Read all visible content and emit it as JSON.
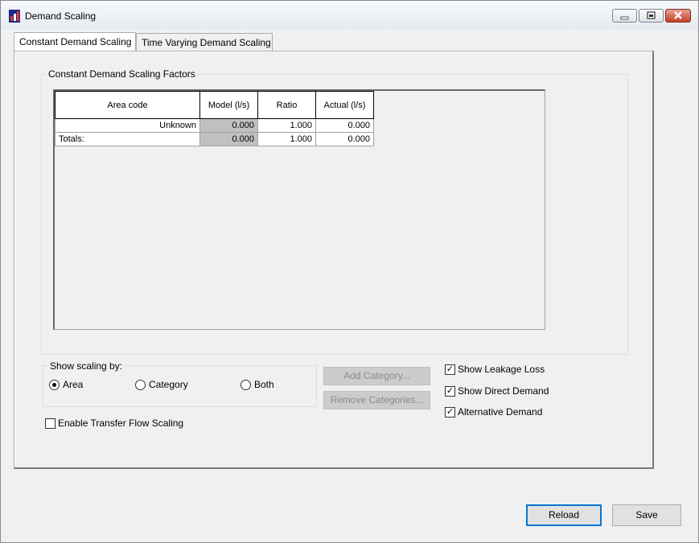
{
  "window": {
    "title": "Demand Scaling"
  },
  "tabs": [
    {
      "label": "Constant Demand Scaling",
      "active": true
    },
    {
      "label": "Time Varying Demand Scaling",
      "active": false
    }
  ],
  "factors_group": {
    "label": "Constant Demand Scaling Factors",
    "columns": [
      "Area code",
      "Model (l/s)",
      "Ratio",
      "Actual (l/s)"
    ],
    "rows": [
      [
        "Unknown",
        "0.000",
        "1.000",
        "0.000"
      ],
      [
        "Totals:",
        "0.000",
        "1.000",
        "0.000"
      ]
    ]
  },
  "show_scaling": {
    "label": "Show scaling by:",
    "options": [
      "Area",
      "Category",
      "Both"
    ],
    "selected": "Area"
  },
  "buttons": {
    "add_category": "Add Category...",
    "remove_categories": "Remove Categories...",
    "reload": "Reload",
    "save": "Save"
  },
  "checkboxes": {
    "show_leakage_loss": {
      "label": "Show Leakage Loss",
      "checked": true
    },
    "show_direct_demand": {
      "label": "Show Direct Demand",
      "checked": true
    },
    "alternative_demand": {
      "label": "Alternative Demand",
      "checked": true
    },
    "enable_transfer_flow": {
      "label": "Enable Transfer Flow Scaling",
      "checked": false
    }
  },
  "check_mark": "✓"
}
